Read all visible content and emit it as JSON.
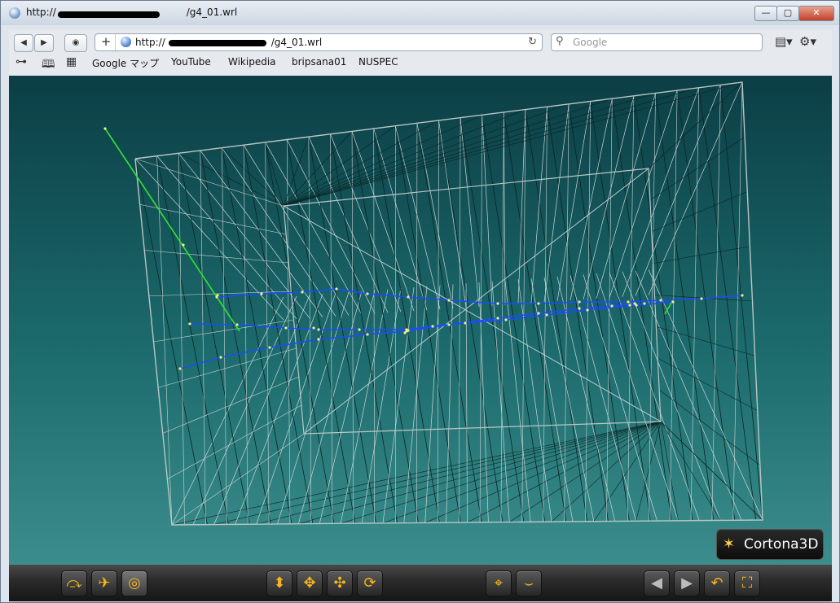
{
  "window": {
    "title": "http://",
    "title_suffix": "/g4_01.wrl",
    "buttons": {
      "minimize": "—",
      "maximize": "▢",
      "close": "✕"
    }
  },
  "toolbar": {
    "url_prefix": "http://",
    "url_suffix": "/g4_01.wrl",
    "new_tab": "+",
    "search_placeholder": "Google"
  },
  "bookmarks": [
    "Google マップ",
    "YouTube",
    "Wikipedia",
    "bripsana01",
    "NUSPEC"
  ],
  "viewer": {
    "logo_text": "Cortona3D",
    "scene_colors": {
      "bg_top": "#0b3e45",
      "bg_bottom": "#3b8d8c",
      "frame": "#b9c6c6",
      "wire_dark": "#0a2424",
      "wire_light": "#c9d6d6",
      "axis_blue": "#1a4cff",
      "axis_green": "#33e433",
      "node": "#f4f07a"
    }
  },
  "controls": {
    "left_group": [
      "walk-icon",
      "fly-icon",
      "study-icon"
    ],
    "middle_group": [
      "plan-icon",
      "pan-icon",
      "turn-icon",
      "roll-icon"
    ],
    "center_group": [
      "goto-icon",
      "align-icon"
    ],
    "right_group": [
      "previous-viewpoint-icon",
      "next-viewpoint-icon",
      "restore-icon",
      "fit-icon"
    ]
  }
}
